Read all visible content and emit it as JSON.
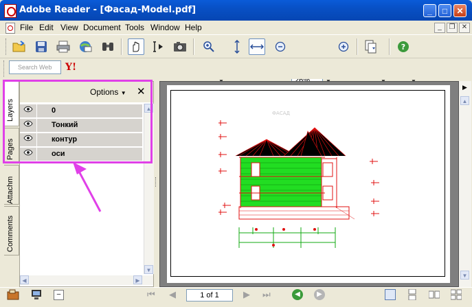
{
  "window": {
    "title": "Adobe Reader - [Фасад-Model.pdf]",
    "minimize": "_",
    "maximize": "□",
    "close": "✕"
  },
  "menubar": {
    "items": [
      "File",
      "Edit",
      "View",
      "Document",
      "Tools",
      "Window",
      "Help"
    ],
    "doc_controls": [
      "_",
      "❐",
      "✕"
    ]
  },
  "toolbar": {
    "zoom_value": "26%",
    "icons": [
      "open-folder",
      "save",
      "print",
      "email",
      "search-binoculars",
      "hand-tool",
      "select-tool",
      "snapshot",
      "zoom-in",
      "fit-page",
      "fit-width",
      "zoom-out",
      "zoom-in-plus",
      "pages-menu",
      "help"
    ]
  },
  "search": {
    "placeholder": "Search Web",
    "logo": "Y!"
  },
  "side_tabs": [
    "Layers",
    "Pages",
    "Attachm",
    "Comments"
  ],
  "layers_panel": {
    "options_label": "Options",
    "close": "✕",
    "layers": [
      "0",
      "Тонкий",
      "контур",
      "оси"
    ]
  },
  "drawing": {
    "title": "ФАСАД"
  },
  "statusbar": {
    "page_indicator": "1 of 1"
  },
  "colors": {
    "highlight": "#e040e8",
    "title_bar": "#0850c5",
    "drawing_red": "#e01010",
    "drawing_green": "#22dd22"
  }
}
